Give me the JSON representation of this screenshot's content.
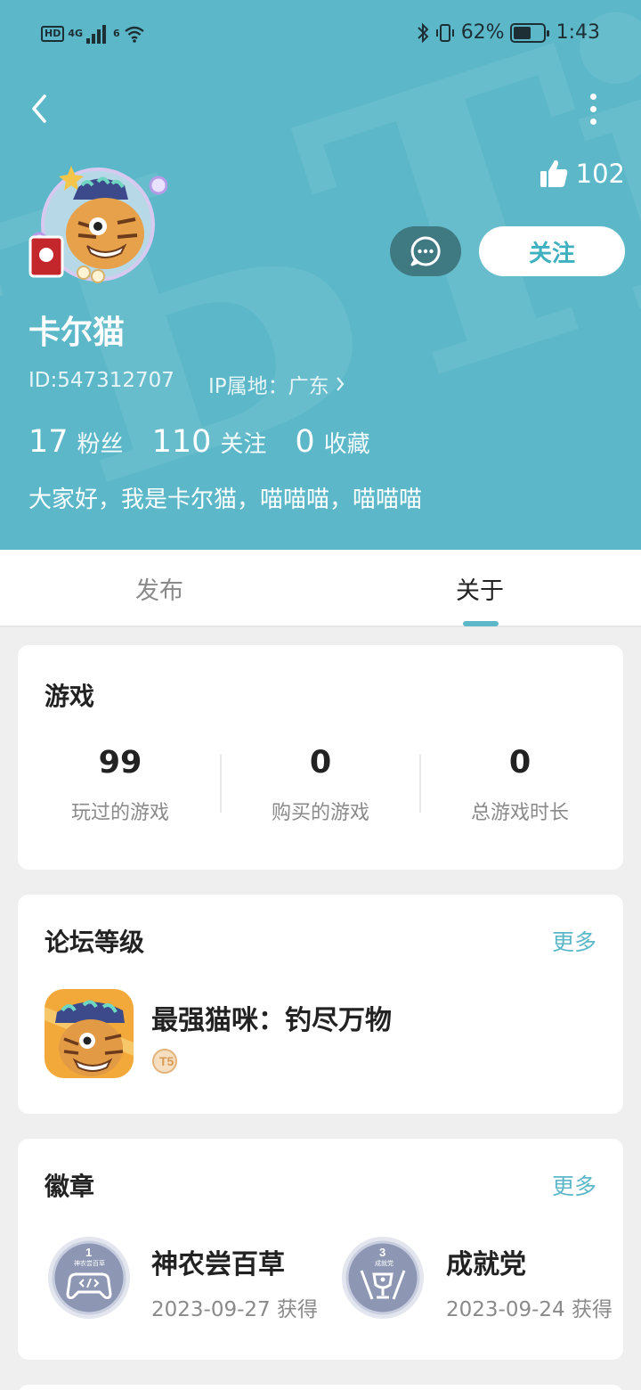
{
  "status_bar": {
    "network_badge": "HD",
    "network_gen": "4G",
    "wifi_gen": "6",
    "battery_percent": "62%",
    "battery_level": 0.62,
    "time": "1:43"
  },
  "colors": {
    "header_bg": "#5cb8c9",
    "accent": "#5cb8c9",
    "chat_button_bg": "#3f7982",
    "follow_text": "#3fb0bf"
  },
  "profile": {
    "likes": "102",
    "follow_label": "关注",
    "name": "卡尔猫",
    "id": "ID:547312707",
    "ip": "IP属地：广东",
    "stats": [
      {
        "value": "17",
        "label": "粉丝"
      },
      {
        "value": "110",
        "label": "关注"
      },
      {
        "value": "0",
        "label": "收藏"
      }
    ],
    "bio": "大家好，我是卡尔猫，喵喵喵，喵喵喵"
  },
  "tabs": [
    {
      "label": "发布",
      "active": false
    },
    {
      "label": "关于",
      "active": true
    }
  ],
  "games": {
    "title": "游戏",
    "stats": [
      {
        "value": "99",
        "label": "玩过的游戏"
      },
      {
        "value": "0",
        "label": "购买的游戏"
      },
      {
        "value": "0",
        "label": "总游戏时长"
      }
    ]
  },
  "forum": {
    "title": "论坛等级",
    "more": "更多",
    "game_name": "最强猫咪：钓尽万物",
    "tier_label": "T5"
  },
  "badges": {
    "title": "徽章",
    "more": "更多",
    "items": [
      {
        "level": "1",
        "caption": "神农尝百草",
        "name": "神农尝百草",
        "date": "2023-09-27 获得"
      },
      {
        "level": "3",
        "caption": "成就党",
        "name": "成就党",
        "date": "2023-09-24 获得"
      }
    ]
  }
}
